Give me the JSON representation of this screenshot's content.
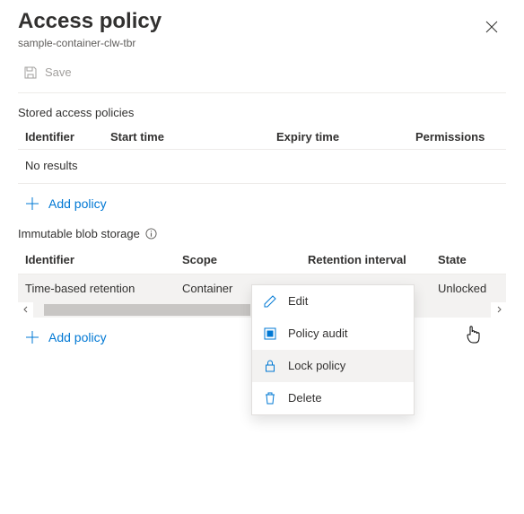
{
  "header": {
    "title": "Access policy",
    "subtitle": "sample-container-clw-tbr"
  },
  "toolbar": {
    "save_label": "Save"
  },
  "stored_policies": {
    "title": "Stored access policies",
    "columns": {
      "id": "Identifier",
      "start": "Start time",
      "expiry": "Expiry time",
      "perms": "Permissions"
    },
    "empty_text": "No results",
    "add_label": "Add policy"
  },
  "immutable": {
    "title": "Immutable blob storage",
    "columns": {
      "id": "Identifier",
      "scope": "Scope",
      "ri": "Retention interval",
      "state": "State"
    },
    "rows": [
      {
        "id": "Time-based retention",
        "scope": "Container",
        "ri": "",
        "state": "Unlocked"
      }
    ],
    "add_label": "Add policy"
  },
  "context_menu": {
    "edit": "Edit",
    "audit": "Policy audit",
    "lock": "Lock policy",
    "delete": "Delete"
  }
}
